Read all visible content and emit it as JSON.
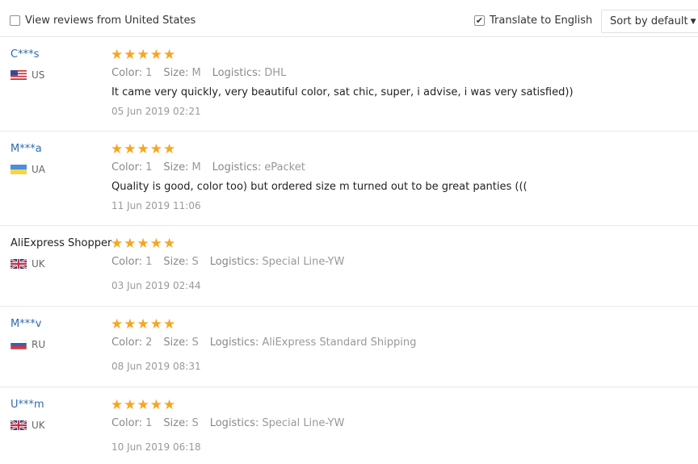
{
  "toolbar": {
    "view_us_label": "View reviews from United States",
    "view_us_checked": false,
    "translate_label": "Translate to English",
    "translate_checked": true,
    "sort_label": "Sort by default",
    "check_glyph": "✔"
  },
  "labels": {
    "color": "Color:",
    "size": "Size:",
    "logistics": "Logistics:"
  },
  "reviews": [
    {
      "user": "C***s",
      "country": "US",
      "flag": "us-flag-icon",
      "rating": 5,
      "color": "1",
      "size": "M",
      "logistics": "DHL",
      "text": "It came very quickly, very beautiful color, sat chic, super, i advise, i was very satisfied))",
      "date": "05 Jun 2019 02:21"
    },
    {
      "user": "M***a",
      "country": "UA",
      "flag": "ua-flag-icon",
      "rating": 5,
      "color": "1",
      "size": "M",
      "logistics": "ePacket",
      "text": "Quality is good, color too) but ordered size m turned out to be great panties (((",
      "date": "11 Jun 2019 11:06"
    },
    {
      "user": "AliExpress Shopper",
      "country": "UK",
      "flag": "uk-flag-icon",
      "rating": 5,
      "color": "1",
      "size": "S",
      "logistics": "Special Line-YW",
      "text": "",
      "date": "03 Jun 2019 02:44"
    },
    {
      "user": "M***v",
      "country": "RU",
      "flag": "ru-flag-icon",
      "rating": 5,
      "color": "2",
      "size": "S",
      "logistics": "AliExpress Standard Shipping",
      "text": "",
      "date": "08 Jun 2019 08:31"
    },
    {
      "user": "U***m",
      "country": "UK",
      "flag": "uk-flag-icon",
      "rating": 5,
      "color": "1",
      "size": "S",
      "logistics": "Special Line-YW",
      "text": "",
      "date": "10 Jun 2019 06:18"
    }
  ],
  "colors": {
    "star": "#f5a623",
    "username_link": "#2e6ab1",
    "muted": "#999999"
  }
}
